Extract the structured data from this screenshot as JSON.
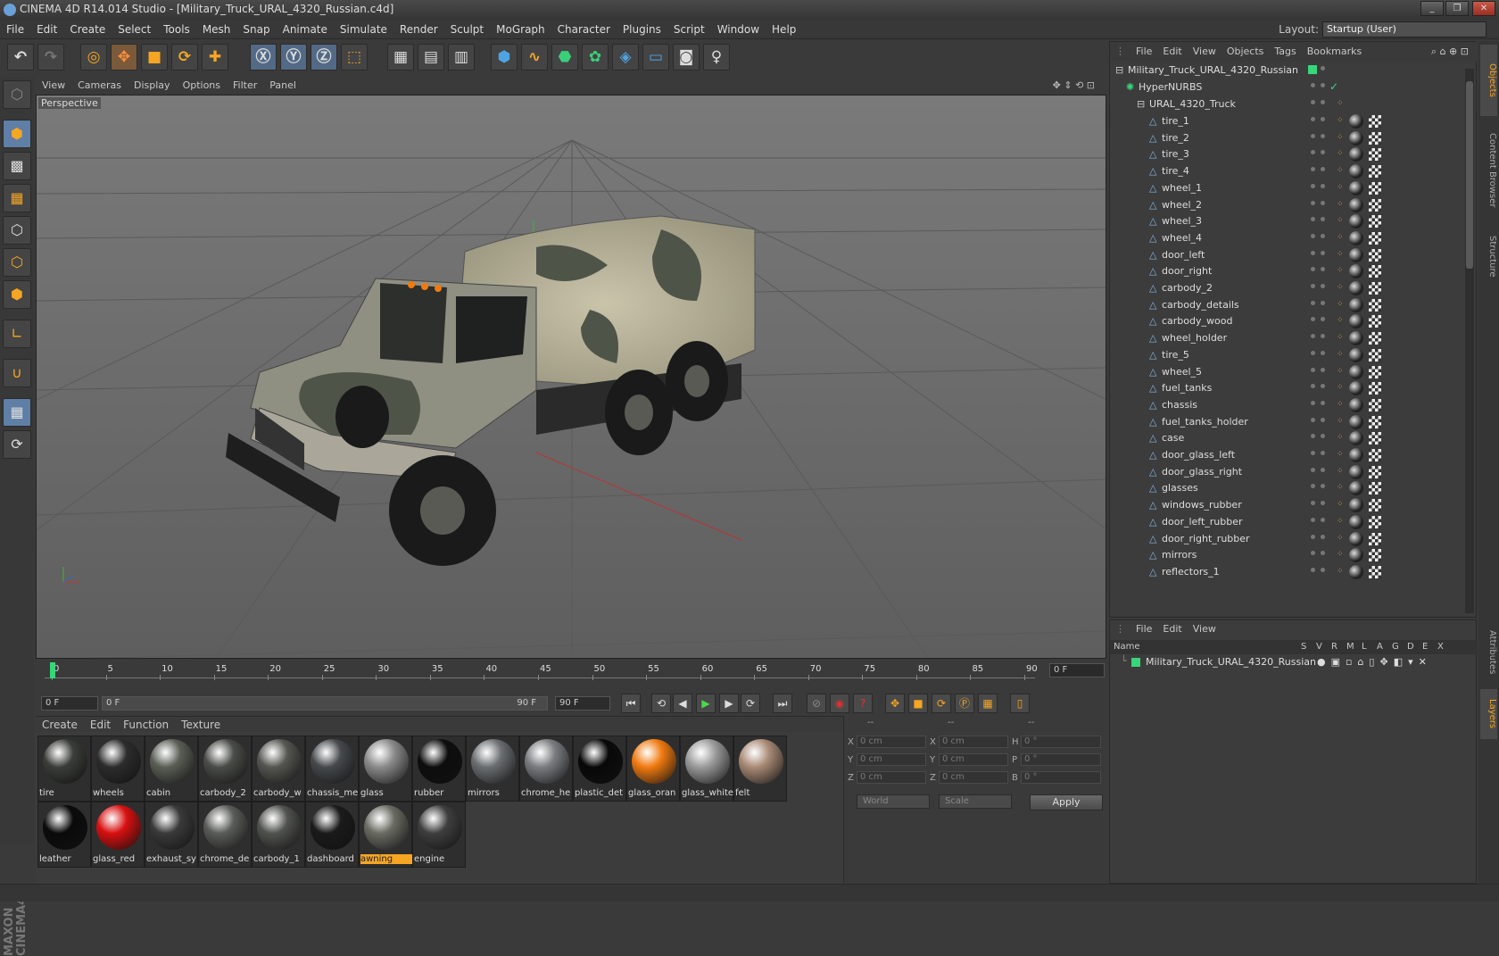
{
  "window": {
    "title": "CINEMA 4D R14.014 Studio - [Military_Truck_URAL_4320_Russian.c4d]",
    "controls": [
      "_",
      "❐",
      "✕"
    ]
  },
  "menubar": {
    "items": [
      "File",
      "Edit",
      "Create",
      "Select",
      "Tools",
      "Mesh",
      "Snap",
      "Animate",
      "Simulate",
      "Render",
      "Sculpt",
      "MoGraph",
      "Character",
      "Plugins",
      "Script",
      "Window",
      "Help"
    ],
    "layout_label": "Layout:",
    "layout_value": "Startup (User)"
  },
  "viewport": {
    "menu": [
      "View",
      "Cameras",
      "Display",
      "Options",
      "Filter",
      "Panel"
    ],
    "label": "Perspective"
  },
  "timeline": {
    "ticks": [
      "0",
      "5",
      "10",
      "15",
      "20",
      "25",
      "30",
      "35",
      "40",
      "45",
      "50",
      "55",
      "60",
      "65",
      "70",
      "75",
      "80",
      "85",
      "90"
    ],
    "current_frame": "0 F"
  },
  "transport": {
    "start": "0 F",
    "range_start": "0 F",
    "range_end": "90 F",
    "end": "90 F"
  },
  "materials": {
    "menu": [
      "Create",
      "Edit",
      "Function",
      "Texture"
    ],
    "items": [
      {
        "name": "tire",
        "color": "#3a3d38"
      },
      {
        "name": "wheels",
        "color": "#2c2c2c"
      },
      {
        "name": "cabin",
        "color": "#5a5e55"
      },
      {
        "name": "carbody_2",
        "color": "#4a4c47"
      },
      {
        "name": "carbody_w",
        "color": "#555650"
      },
      {
        "name": "chassis_me",
        "color": "#45494c"
      },
      {
        "name": "glass",
        "color": "#8a8a8a"
      },
      {
        "name": "rubber",
        "color": "#0d0d0d"
      },
      {
        "name": "mirrors",
        "color": "#6a6e70"
      },
      {
        "name": "chrome_he",
        "color": "#7a7d80"
      },
      {
        "name": "plastic_det",
        "color": "#080808"
      },
      {
        "name": "glass_oran",
        "color": "#f07a10"
      },
      {
        "name": "glass_white",
        "color": "#9a9a9a"
      },
      {
        "name": "felt",
        "color": "#a88a75"
      },
      {
        "name": "leather",
        "color": "#0a0a0a"
      },
      {
        "name": "glass_red",
        "color": "#d81010"
      },
      {
        "name": "exhaust_sy",
        "color": "#3a3a3a"
      },
      {
        "name": "chrome_de",
        "color": "#5a5c58"
      },
      {
        "name": "carbody_1",
        "color": "#50524e"
      },
      {
        "name": "dashboard",
        "color": "#1a1a1a"
      },
      {
        "name": "awning",
        "color": "#6a6b62"
      },
      {
        "name": "engine",
        "color": "#3e3e3e"
      }
    ],
    "selected": "awning"
  },
  "coords": {
    "headers": [
      "--",
      "--",
      "--"
    ],
    "rows": [
      {
        "a": "X",
        "av": "0 cm",
        "b": "X",
        "bv": "0 cm",
        "c": "H",
        "cv": "0 °"
      },
      {
        "a": "Y",
        "av": "0 cm",
        "b": "Y",
        "bv": "0 cm",
        "c": "P",
        "cv": "0 °"
      },
      {
        "a": "Z",
        "av": "0 cm",
        "b": "Z",
        "bv": "0 cm",
        "c": "B",
        "cv": "0 °"
      }
    ],
    "space": "World",
    "mode": "Scale",
    "apply": "Apply"
  },
  "objects": {
    "menu": [
      "File",
      "Edit",
      "View",
      "Objects",
      "Tags",
      "Bookmarks"
    ],
    "root": "Military_Truck_URAL_4320_Russian",
    "hypernurbs": "HyperNURBS",
    "group": "URAL_4320_Truck",
    "children": [
      "tire_1",
      "tire_2",
      "tire_3",
      "tire_4",
      "wheel_1",
      "wheel_2",
      "wheel_3",
      "wheel_4",
      "door_left",
      "door_right",
      "carbody_2",
      "carbody_details",
      "carbody_wood",
      "wheel_holder",
      "tire_5",
      "wheel_5",
      "fuel_tanks",
      "chassis",
      "fuel_tanks_holder",
      "case",
      "door_glass_left",
      "door_glass_right",
      "glasses",
      "windows_rubber",
      "door_left_rubber",
      "door_right_rubber",
      "mirrors",
      "reflectors_1"
    ]
  },
  "layers": {
    "menu": [
      "File",
      "Edit",
      "View"
    ],
    "columns": [
      "Name",
      "S",
      "V",
      "R",
      "M",
      "L",
      "A",
      "G",
      "D",
      "E",
      "X"
    ],
    "row": "Military_Truck_URAL_4320_Russian"
  },
  "right_tabs": [
    "Objects",
    "Content Browser",
    "Structure",
    "Attributes",
    "Layers"
  ],
  "colors": {
    "accent": "#f6a623",
    "layer_green": "#37d67a",
    "selected_label_bg": "#f6a623"
  }
}
